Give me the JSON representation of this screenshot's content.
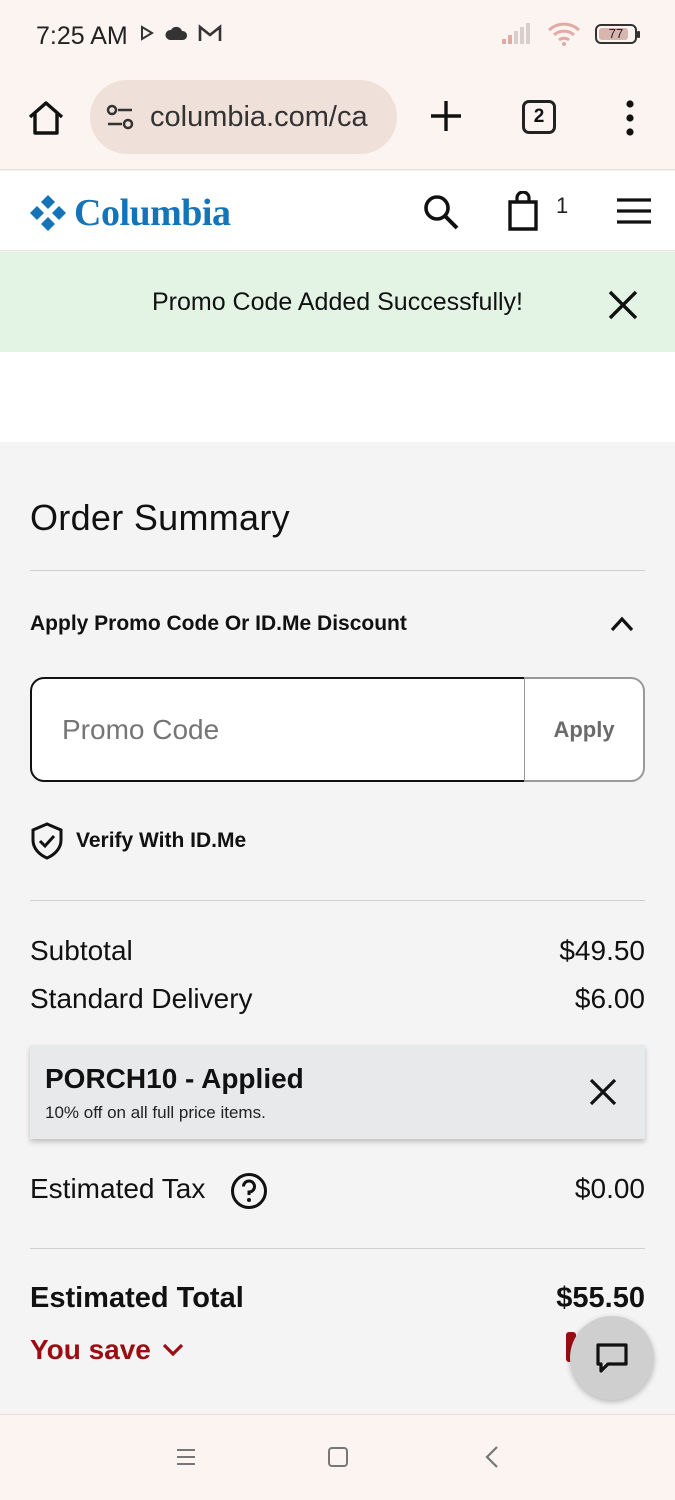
{
  "status_bar": {
    "time": "7:25 AM",
    "battery_level": "77",
    "icons": [
      "play-icon",
      "cloud-icon",
      "gmail-icon",
      "signal-icon",
      "wifi-icon",
      "battery-icon"
    ]
  },
  "browser": {
    "url": "columbia.com/ca",
    "tab_count": "2",
    "icons": [
      "home-icon",
      "site-settings-icon",
      "new-tab-icon",
      "tabs-icon",
      "more-icon"
    ]
  },
  "site": {
    "brand": "Columbia",
    "cart_count": "1",
    "brand_color": "#1574b8",
    "icons": [
      "search-icon",
      "shopping-bag-icon",
      "hamburger-menu-icon"
    ]
  },
  "banner": {
    "message": "Promo Code Added Successfully!",
    "background": "#e3f4e5"
  },
  "order_summary": {
    "title": "Order Summary",
    "promo_section_label": "Apply Promo Code Or ID.Me Discount",
    "promo_placeholder": "Promo Code",
    "promo_value": "",
    "apply_label": "Apply",
    "verify_label": "Verify With ID.Me",
    "subtotal_label": "Subtotal",
    "subtotal_value": "$49.50",
    "delivery_label": "Standard Delivery",
    "delivery_value": "$6.00",
    "applied_code_title": "PORCH10 - Applied",
    "applied_code_desc": "10% off on all full price items.",
    "tax_label": "Estimated Tax",
    "tax_value": "$0.00",
    "total_label": "Estimated Total",
    "total_value": "$55.50",
    "you_save_label": "You save",
    "you_save_color": "#9a0d12"
  },
  "chat": {
    "icon": "chat-icon"
  },
  "nav_bar": {
    "icons": [
      "recent-apps-icon",
      "home-button-icon",
      "back-icon"
    ]
  }
}
